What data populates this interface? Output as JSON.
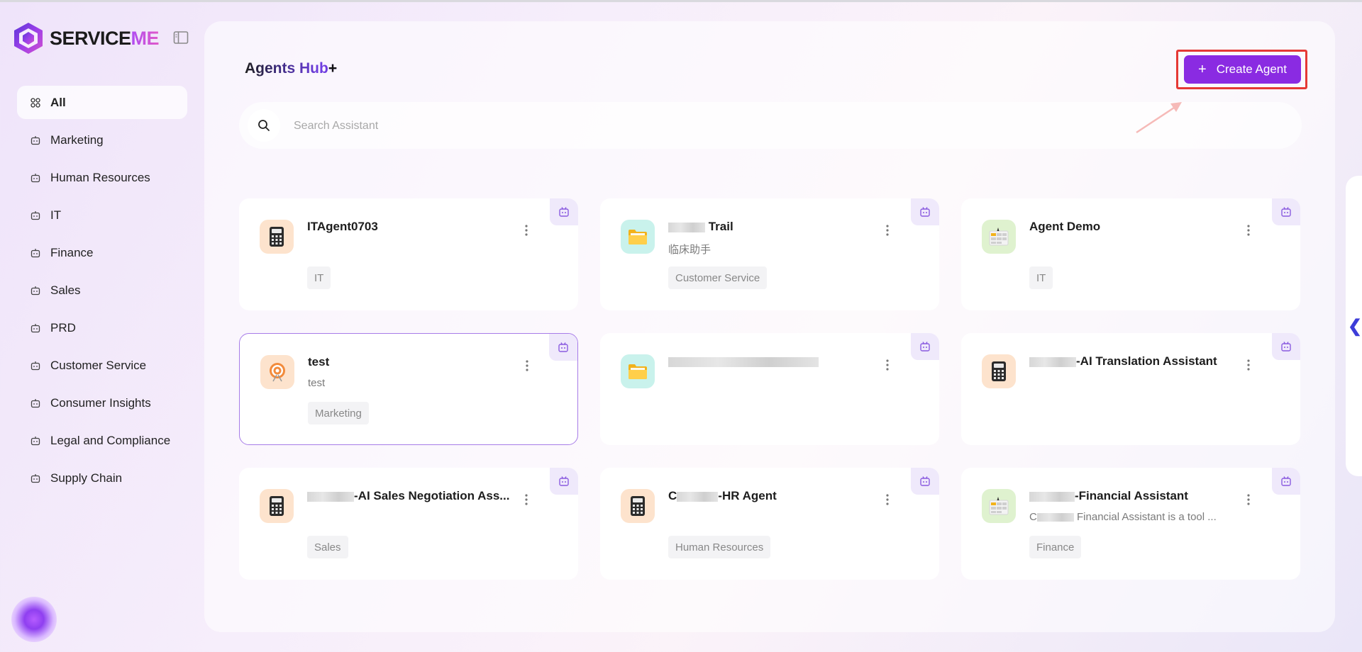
{
  "brand": {
    "name_part1": "SERVICE",
    "name_part2": "ME"
  },
  "sidebar": {
    "items": [
      {
        "label": "All",
        "active": true
      },
      {
        "label": "Marketing"
      },
      {
        "label": "Human Resources"
      },
      {
        "label": "IT"
      },
      {
        "label": "Finance"
      },
      {
        "label": "Sales"
      },
      {
        "label": "PRD"
      },
      {
        "label": "Customer Service"
      },
      {
        "label": "Consumer Insights"
      },
      {
        "label": "Legal and Compliance"
      },
      {
        "label": "Supply Chain"
      }
    ]
  },
  "header": {
    "title": "Agents Hub",
    "title_suffix": "+",
    "create_plus": "+",
    "create_label": "Create Agent"
  },
  "search": {
    "placeholder": "Search Assistant"
  },
  "cards": [
    {
      "title": "ITAgent0703",
      "description": "",
      "tag": "IT",
      "icon": "calculator-icon",
      "color": "#fde3cd"
    },
    {
      "title_visible_suffix": "Trail",
      "title_masked": "Mindray",
      "description": "临床助手",
      "tag": "Customer Service",
      "icon": "folder-icon",
      "color": "#c9f2ec"
    },
    {
      "title": "Agent Demo",
      "description": "",
      "tag": "IT",
      "icon": "spreadsheet-icon",
      "color": "#dff2cf"
    },
    {
      "title": "test",
      "description": "test",
      "tag": "Marketing",
      "icon": "target-icon",
      "color": "#fde3cd"
    },
    {
      "title": "",
      "description": "",
      "tag": "",
      "icon": "folder-icon",
      "color": "#c9f2ec"
    },
    {
      "title_visible_suffix": "-AI Translation Assistant",
      "description": "",
      "tag": "",
      "icon": "calculator-icon",
      "color": "#fde3cd"
    },
    {
      "title_visible_suffix": "-AI Sales Negotiation Ass...",
      "description": "",
      "tag": "Sales",
      "icon": "calculator-icon",
      "color": "#fde3cd"
    },
    {
      "title_visible_prefix": "C",
      "title_visible_suffix": "-HR Agent",
      "description": "",
      "tag": "Human Resources",
      "icon": "calculator-icon",
      "color": "#fde3cd"
    },
    {
      "title_visible_suffix": "-Financial Assistant",
      "description_prefix": "C",
      "description_suffix": " Financial Assistant is a tool ...",
      "tag": "Finance",
      "icon": "spreadsheet-icon",
      "color": "#dff2cf"
    }
  ],
  "colors": {
    "accent": "#8a2be2",
    "highlight_box": "#e53935",
    "selected_border": "#a77ce8"
  }
}
